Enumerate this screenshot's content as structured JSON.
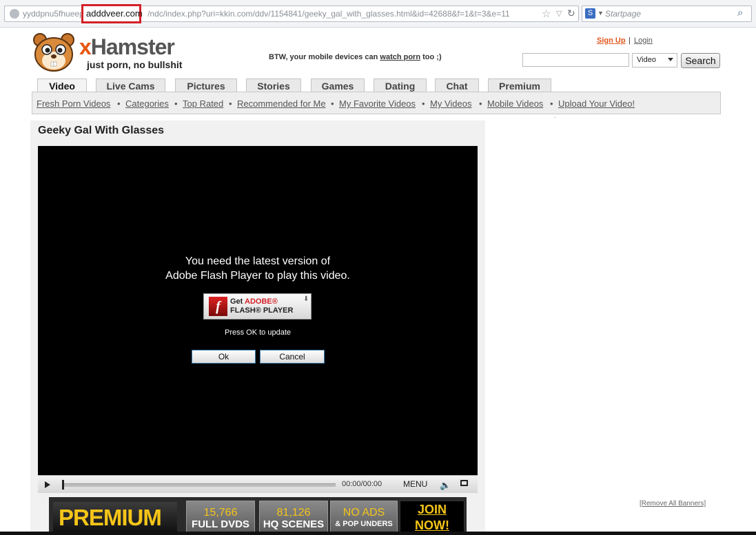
{
  "browser": {
    "url_prefix": "yyddpnu5fhueep.",
    "url_highlighted_domain": "adddveer.com",
    "url_rest": "/ndc/index.php?uri=kkin.com/ddv/1154841/geeky_gal_with_glasses.html&id=42688&f=1&t=3&e=11",
    "search_placeholder": "Startpage"
  },
  "header": {
    "logo_name_x": "x",
    "logo_name_rest": "Hamster",
    "tagline": "just porn, no bullshit",
    "btw_prefix": "BTW, your mobile devices can",
    "btw_link": "watch porn",
    "btw_suffix": "too ;)",
    "sign_up": "Sign Up",
    "separator": "|",
    "login": "Login",
    "search_select_value": "Video",
    "search_button": "Search"
  },
  "tabs": [
    {
      "label": "Video",
      "active": true
    },
    {
      "label": "Live Cams"
    },
    {
      "label": "Pictures"
    },
    {
      "label": "Stories"
    },
    {
      "label": "Games"
    },
    {
      "label": "Dating"
    },
    {
      "label": "Chat"
    },
    {
      "label": "Premium"
    }
  ],
  "subnav": [
    "Fresh Porn Videos",
    "Categories",
    "Top Rated",
    "Recommended for Me",
    "My Favorite Videos",
    "My Videos",
    "Mobile Videos",
    "Upload Your Video!"
  ],
  "video": {
    "title": "Geeky Gal With Glasses",
    "message_line1": "You need the latest version of",
    "message_line2": "Adobe Flash Player to play this video.",
    "flash_get": "Get",
    "flash_adobe": "ADOBE®",
    "flash_player": "FLASH® PLAYER",
    "flash_logo": "f",
    "press_ok": "Press OK to update",
    "ok_button": "Ok",
    "cancel_button": "Cancel",
    "time": "00:00/00:00",
    "menu": "MENU"
  },
  "banner": {
    "premium": "PREMIUM",
    "box1_big": "15,766",
    "box1_small": "FULL DVDS",
    "box2_big": "81,126",
    "box2_small": "HQ SCENES",
    "box3_big": "NO ADS",
    "box3_small": "& POP UNDERS",
    "join_line1": "JOIN",
    "join_line2": "NOW!"
  },
  "remove_banners": "[Remove All Banners]",
  "colors": {
    "brand_orange": "#e8540c",
    "premium_yellow": "#f5c518",
    "highlight_red": "#d31f26"
  }
}
